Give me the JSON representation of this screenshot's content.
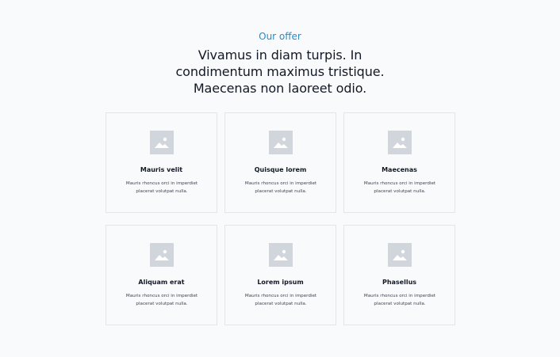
{
  "header": {
    "eyebrow": "Our offer",
    "headline_lines": [
      "Vivamus in diam turpis. In",
      "condimentum maximus tristique.",
      "Maecenas non laoreet odio."
    ]
  },
  "cards": [
    {
      "icon": "image-placeholder-icon",
      "title": "Mauris velit",
      "desc_lines": [
        "Mauris rhoncus orci in imperdiet",
        "placerat volutpat nulla."
      ]
    },
    {
      "icon": "image-placeholder-icon",
      "title": "Quisque lorem",
      "desc_lines": [
        "Mauris rhoncus orci in imperdiet",
        "placerat volutpat nulla."
      ]
    },
    {
      "icon": "image-placeholder-icon",
      "title": "Maecenas",
      "desc_lines": [
        "Mauris rhoncus orci in imperdiet",
        "placerat volutpat nulla."
      ]
    },
    {
      "icon": "image-placeholder-icon",
      "title": "Aliquam erat",
      "desc_lines": [
        "Mauris rhoncus orci in imperdiet",
        "placerat volutpat nulla."
      ]
    },
    {
      "icon": "image-placeholder-icon",
      "title": "Lorem ipsum",
      "desc_lines": [
        "Mauris rhoncus orci in imperdiet",
        "placerat volutpat nulla."
      ]
    },
    {
      "icon": "image-placeholder-icon",
      "title": "Phasellus",
      "desc_lines": [
        "Mauris rhoncus orci in imperdiet",
        "placerat volutpat nulla."
      ]
    }
  ],
  "colors": {
    "accent": "#1a8fd6",
    "text": "#121826",
    "muted": "#3c4350",
    "background": "#f9fafb",
    "border": "#e3e5e8",
    "placeholder": "#d1d5dc"
  }
}
